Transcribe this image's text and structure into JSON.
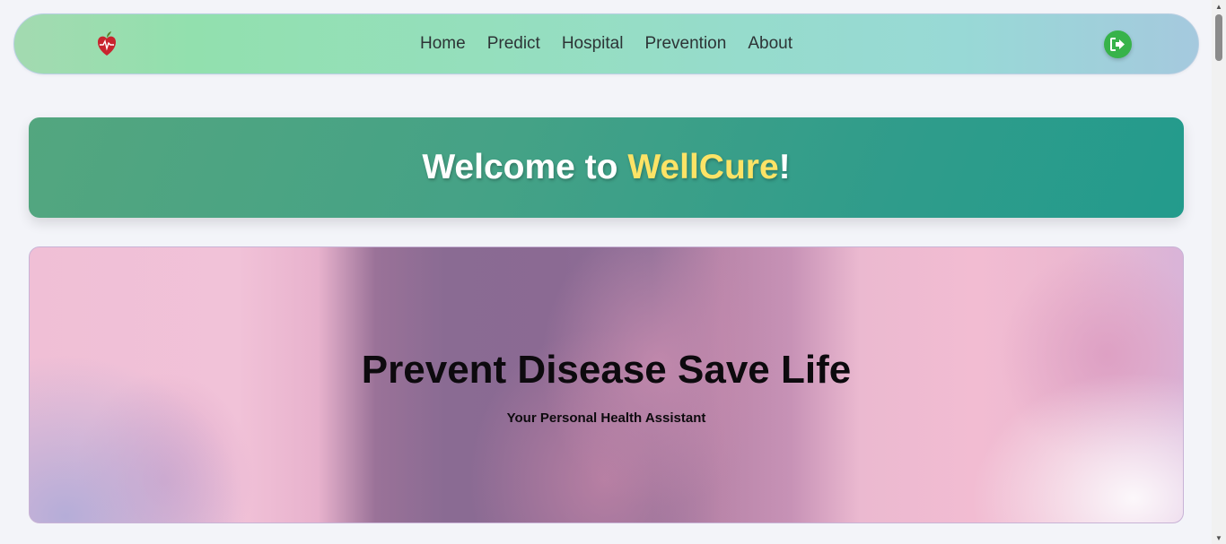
{
  "nav": {
    "links": [
      "Home",
      "Predict",
      "Hospital",
      "Prevention",
      "About"
    ],
    "logo_icon": "heart-apple-icon",
    "logout_icon": "sign-out-icon"
  },
  "welcome": {
    "prefix": "Welcome to ",
    "brand": "WellCure",
    "suffix": "!"
  },
  "hero": {
    "title": "Prevent Disease Save Life",
    "subtitle": "Your Personal Health Assistant"
  },
  "colors": {
    "brand_yellow": "#fce366",
    "logout_green": "#37b34a",
    "banner_teal": "#239b8c"
  }
}
